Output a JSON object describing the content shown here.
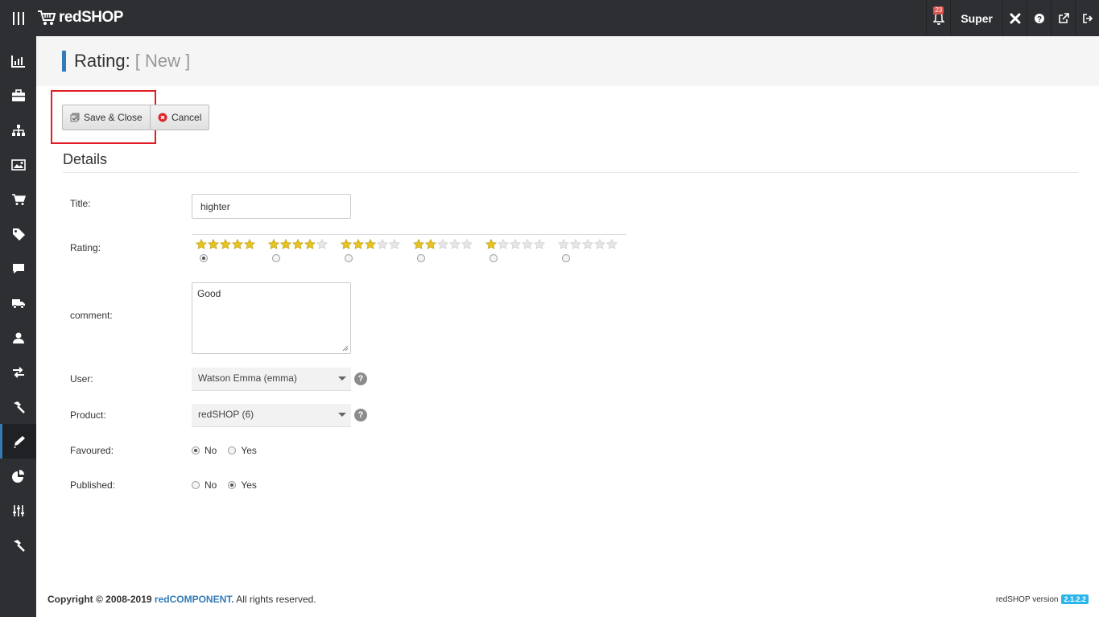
{
  "app": {
    "brand": "redSHOP"
  },
  "topbar": {
    "notification_count": "23",
    "user_label": "Super"
  },
  "page": {
    "title": "Rating:",
    "subtitle": "[ New ]"
  },
  "toolbar": {
    "save_close_label": "Save & Close",
    "cancel_label": "Cancel"
  },
  "details": {
    "heading": "Details",
    "title_label": "Title:",
    "title_value": "highter",
    "rating_label": "Rating:",
    "rating_options": [
      5,
      4,
      3,
      2,
      1,
      0
    ],
    "rating_selected": 5,
    "comment_label": "comment:",
    "comment_value": "Good",
    "user_label": "User:",
    "user_value": "Watson Emma (emma)",
    "product_label": "Product:",
    "product_value": "redSHOP (6)",
    "favoured_label": "Favoured:",
    "favoured_no": "No",
    "favoured_yes": "Yes",
    "favoured_selected": "No",
    "published_label": "Published:",
    "published_no": "No",
    "published_yes": "Yes",
    "published_selected": "Yes"
  },
  "footer": {
    "copyright": "Copyright © 2008-2019",
    "company": "redCOMPONENT.",
    "rights": "All rights reserved.",
    "version_label": "redSHOP version",
    "version": "2.1.2.2"
  },
  "colors": {
    "accent": "#337ab7",
    "highlight": "#e21c24",
    "star": "#e8c21f"
  }
}
